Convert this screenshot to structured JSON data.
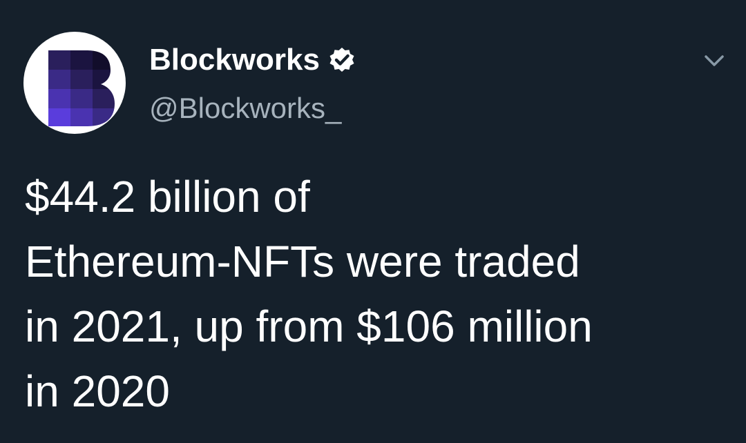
{
  "tweet": {
    "author": {
      "display_name": "Blockworks",
      "handle": "@Blockworks_",
      "verified": true,
      "avatar_icon": "blockworks-b-logo"
    },
    "text_lines": [
      "$44.2 billion of",
      "Ethereum-NFTs were traded",
      "in 2021, up from $106 million",
      "in 2020"
    ],
    "menu_icon": "chevron-down-icon"
  },
  "colors": {
    "background": "#15202b",
    "text": "#ffffff",
    "secondary_text": "#a7b3bd",
    "logo_purple": "#5a36d6"
  }
}
